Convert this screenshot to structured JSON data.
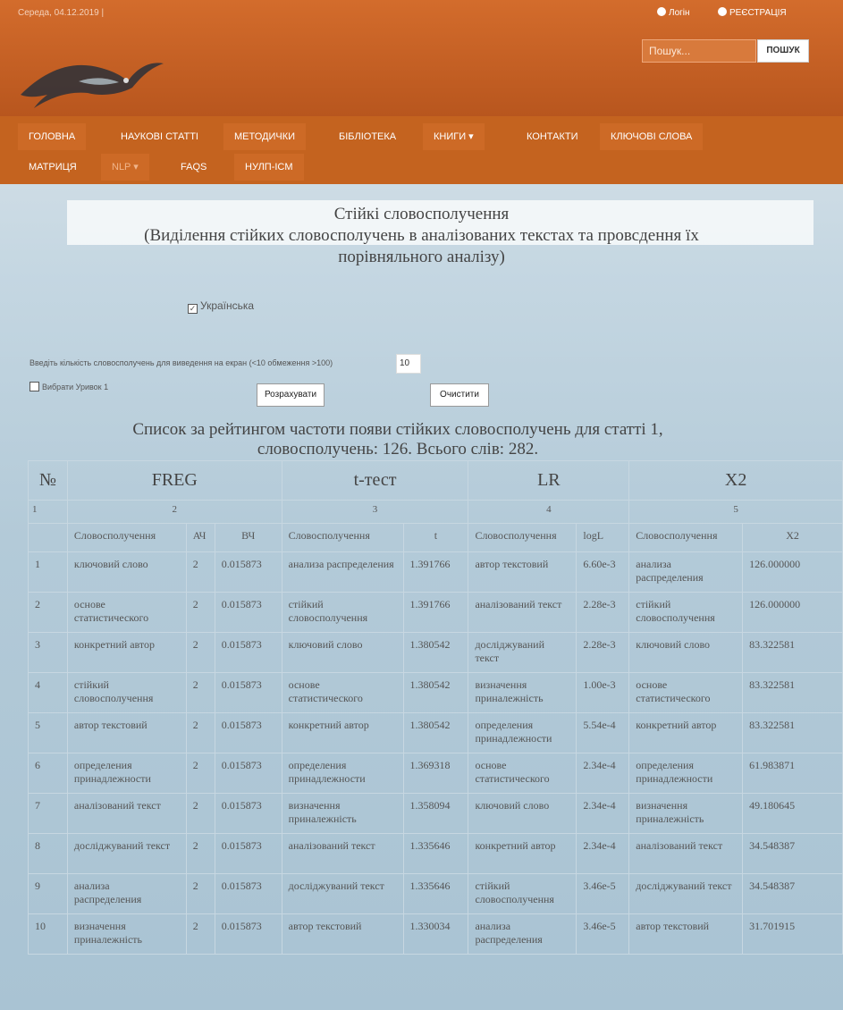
{
  "topbar": {
    "date": "Середа, 04.12.2019 |",
    "login": "Логін",
    "register": "РЕЄСТРАЦІЯ"
  },
  "search": {
    "placeholder": "Пошук...",
    "button": "ПОШУК"
  },
  "nav": {
    "row1": [
      "ГОЛОВНА",
      "НАУКОВІ СТАТТІ",
      "МЕТОДИЧКИ",
      "БІБЛІОТЕКА",
      "КНИГИ ▾",
      "КОНТАКТИ",
      "КЛЮЧОВІ СЛОВА"
    ],
    "row2": [
      "МАТРИЦЯ",
      "NLP ▾",
      "FAQS",
      "НУЛП-ICM"
    ]
  },
  "page": {
    "title_line1": "Стійкі словосполучення",
    "title_line2": "(Виділення стійких словосполучень в аналізованих текстах та провсдення їх",
    "title_line3": "порівняльного аналізу)",
    "language_label": "Українська",
    "count_label": "Введіть кількість словосполучень для виведення на екран  (<10 обмеження >100)",
    "count_value": "10",
    "excerpt_label": "Вибрати Уривок 1",
    "calc_button": "Розрахувати",
    "clear_button": "Очистити",
    "list_title_line1": "Список за рейтингом частоти появи стійких словосполучень для статті 1,",
    "list_title_line2": "словосполучень: 126. Всього слів: 282."
  },
  "table": {
    "groups": [
      "№",
      "FREG",
      "t-тест",
      "LR",
      "X2"
    ],
    "group_numbers": [
      "1",
      "2",
      "3",
      "4",
      "5"
    ],
    "subheaders": [
      "",
      "Словосполучення",
      "АЧ",
      "ВЧ",
      "Словосполучення",
      "t",
      "Словосполучення",
      "logL",
      "Словосполучення",
      "X2"
    ],
    "rows": [
      [
        "1",
        "ключовий слово",
        "2",
        "0.015873",
        "анализа распределения",
        "1.391766",
        "автор текстовий",
        "6.60e-3",
        "анализа распределения",
        "126.000000"
      ],
      [
        "2",
        "основе статистического",
        "2",
        "0.015873",
        "стійкий словосполучення",
        "1.391766",
        "аналізований текст",
        "2.28e-3",
        "стійкий словосполучення",
        "126.000000"
      ],
      [
        "3",
        "конкретний автор",
        "2",
        "0.015873",
        "ключовий слово",
        "1.380542",
        "досліджуваний текст",
        "2.28e-3",
        "ключовий слово",
        "83.322581"
      ],
      [
        "4",
        "стійкий словосполучення",
        "2",
        "0.015873",
        "основе статистического",
        "1.380542",
        "визначення приналежність",
        "1.00e-3",
        "основе статистического",
        "83.322581"
      ],
      [
        "5",
        "автор текстовий",
        "2",
        "0.015873",
        "конкретний автор",
        "1.380542",
        "определения принадлежности",
        "5.54e-4",
        "конкретний автор",
        "83.322581"
      ],
      [
        "6",
        "определения принадлежности",
        "2",
        "0.015873",
        "определения принадлежности",
        "1.369318",
        "основе статистического",
        "2.34e-4",
        "определения принадлежности",
        "61.983871"
      ],
      [
        "7",
        "аналізований текст",
        "2",
        "0.015873",
        "визначення приналежність",
        "1.358094",
        "ключовий слово",
        "2.34e-4",
        "визначення приналежність",
        "49.180645"
      ],
      [
        "8",
        "досліджуваний текст",
        "2",
        "0.015873",
        "аналізований текст",
        "1.335646",
        "конкретний автор",
        "2.34e-4",
        "аналізований текст",
        "34.548387"
      ],
      [
        "9",
        "анализа распределения",
        "2",
        "0.015873",
        "досліджуваний текст",
        "1.335646",
        "стійкий словосполучення",
        "3.46e-5",
        "досліджуваний текст",
        "34.548387"
      ],
      [
        "10",
        "визначення приналежність",
        "2",
        "0.015873",
        "автор текстовий",
        "1.330034",
        "анализа распределения",
        "3.46e-5",
        "автор текстовий",
        "31.701915"
      ]
    ]
  }
}
